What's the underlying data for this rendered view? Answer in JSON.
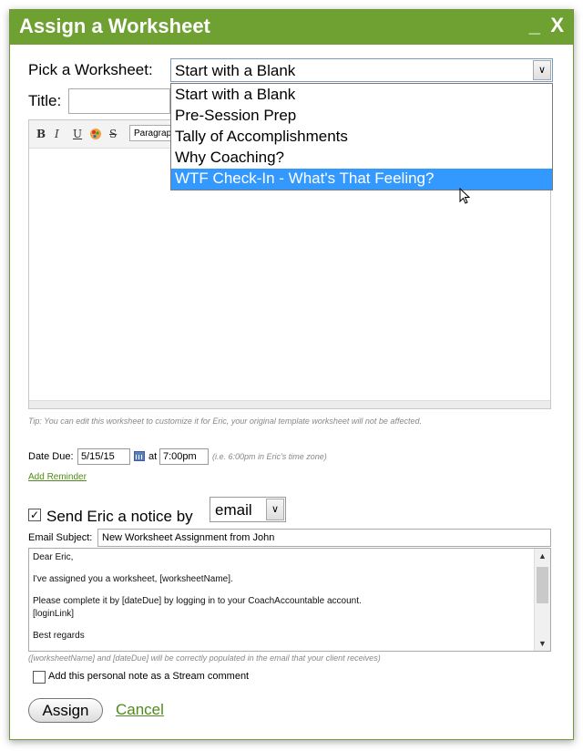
{
  "dialog": {
    "title": "Assign a Worksheet",
    "minimize_label": "_",
    "close_label": "X",
    "accent_color": "#6ea131"
  },
  "worksheet_picker": {
    "label": "Pick a Worksheet:",
    "selected_value": "Start with a Blank",
    "options": [
      "Start with a Blank",
      "Pre-Session Prep",
      "Tally of Accomplishments",
      "Why Coaching?",
      "WTF Check-In - What's That Feeling?"
    ],
    "highlighted_option": "WTF Check-In - What's That Feeling?"
  },
  "title_field": {
    "label": "Title:",
    "value": ""
  },
  "editor": {
    "toolbar": {
      "bold": "B",
      "italic": "I",
      "underline": "U",
      "strike": "S",
      "paragraph": "Paragrap",
      "color_icon": "color-palette-icon"
    },
    "tip": "Tip: You can edit this worksheet to customize it for Eric, your original template worksheet will not be affected."
  },
  "due": {
    "label": "Date Due:",
    "date_value": "5/15/15",
    "at_label": "at",
    "time_value": "7:00pm",
    "timezone_hint": "(i.e. 6:00pm in Eric's time zone)",
    "add_reminder": "Add Reminder"
  },
  "notice": {
    "checked": true,
    "label": "Send Eric a notice by",
    "method": "email",
    "subject_label": "Email Subject:",
    "subject_value": "New Worksheet Assignment from John",
    "body_lines": [
      "Dear Eric,",
      "I've assigned you a worksheet, [worksheetName].",
      "Please complete it by [dateDue] by logging in to your CoachAccountable account.",
      "[loginLink]",
      "Best regards"
    ],
    "populate_note": "([worksheetName] and [dateDue] will be correctly populated in the email that your client receives)",
    "stream_checked": false,
    "stream_label": "Add this personal note as a Stream comment"
  },
  "actions": {
    "assign": "Assign",
    "cancel": "Cancel"
  }
}
